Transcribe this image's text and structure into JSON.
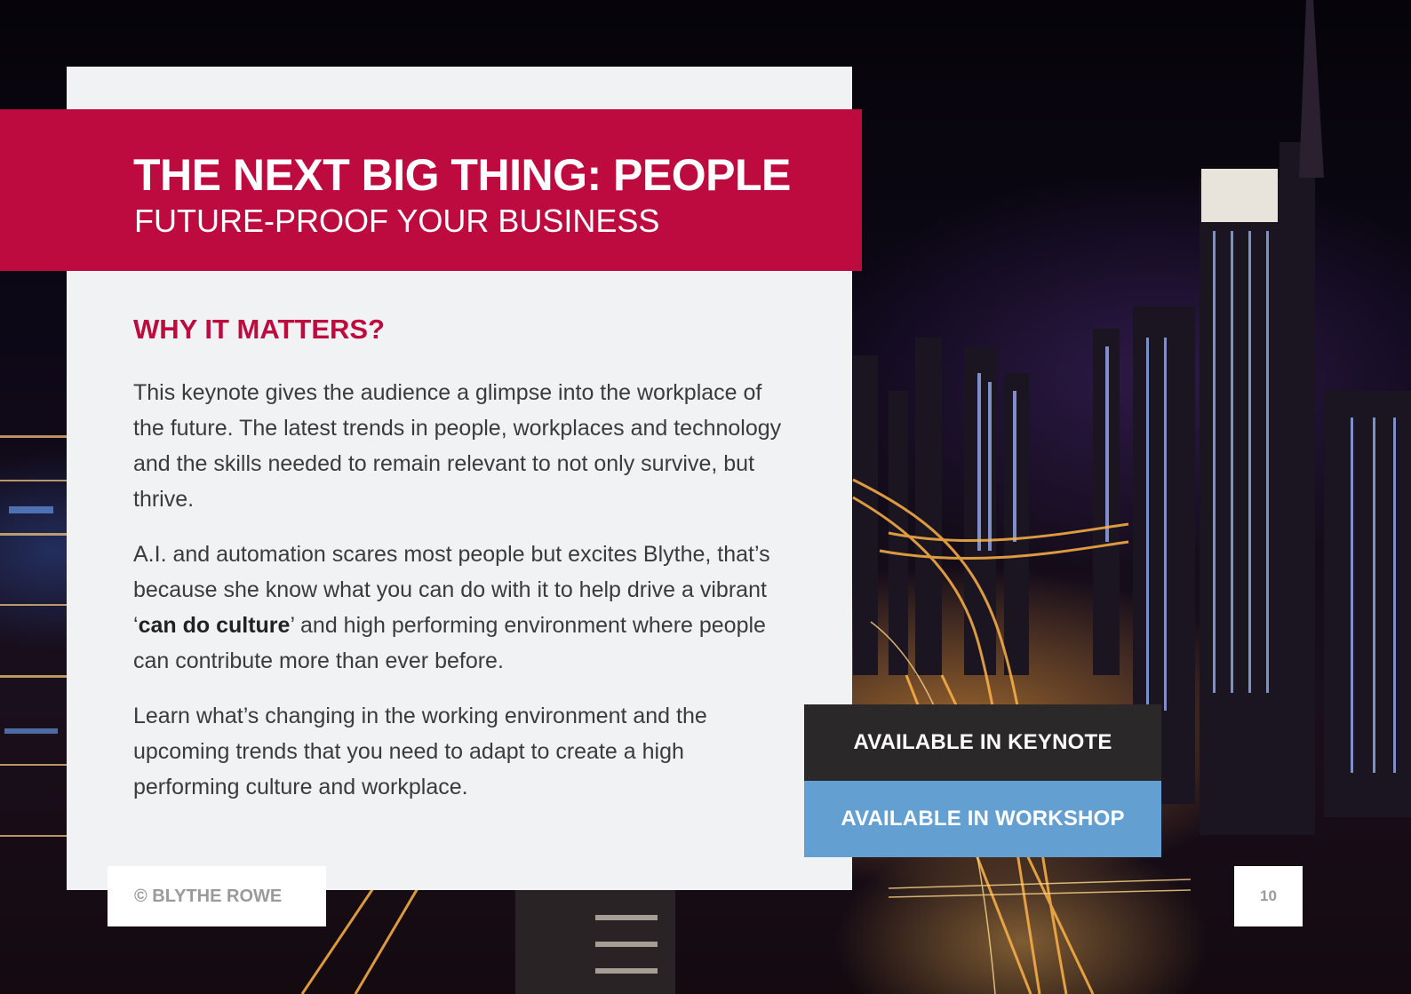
{
  "header": {
    "title": "THE NEXT BIG THING: PEOPLE",
    "subtitle": "FUTURE-PROOF YOUR BUSINESS"
  },
  "section": {
    "heading": "WHY IT MATTERS?",
    "p1": "This keynote gives the audience a glimpse into the workplace of the future. The latest trends in people, workplaces and technology and the skills needed to remain relevant to not only survive, but thrive.",
    "p2_before": "A.I. and automation scares most people but excites Blythe, that’s because she know what you can do with it to help drive a vibrant ‘",
    "p2_bold": "can do culture",
    "p2_after": "’ and high performing environment where people can contribute more than ever before.",
    "p3": "Learn what’s changing in the working environment and the upcoming trends that you need to adapt to create a high performing culture and workplace."
  },
  "availability": {
    "keynote_label": "AVAILABLE IN KEYNOTE",
    "workshop_label": "AVAILABLE IN WORKSHOP"
  },
  "footer": {
    "copyright": "© BLYTHE ROWE",
    "page_number": "10"
  },
  "colors": {
    "accent": "#bd0a3f",
    "keynote_bg": "#2a2829",
    "workshop_bg": "#649fd1",
    "panel_bg": "#f1f2f4"
  },
  "background_image": "night-city-skyline"
}
